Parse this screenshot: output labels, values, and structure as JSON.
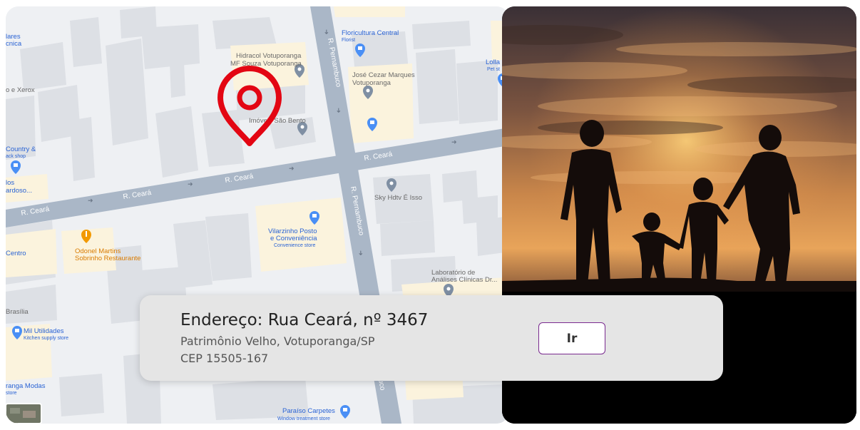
{
  "map": {
    "streets": {
      "ceara_1": "R. Ceará",
      "ceara_2": "R. Ceará",
      "ceara_3": "R. Ceará",
      "ceara_4": "R. Ceará",
      "pernambuco_1": "R. Pernambuco",
      "pernambuco_2": "R. Pernambuco",
      "pernambuco_3": "uco"
    },
    "places": {
      "hidracol_1": "Hidracol Votuporanga",
      "hidracol_2": "MF Souza Votuporanga",
      "imoveis": "Imóveis São Bento",
      "floricultura": "Floricultura Central",
      "floricultura_sub": "Florist",
      "jose_1": "José Cezar Marques",
      "jose_2": "Votuporanga",
      "lolla": "Lolla",
      "lolla_sub": "Pet st",
      "sky": "Sky Hdtv É Isso",
      "vilarzinho_1": "Vilarzinho Posto",
      "vilarzinho_2": "e Conveniência",
      "vilarzinho_sub": "Convenience store",
      "odonel_1": "Odonel Martins",
      "odonel_2": "Sobrinho Restaurante",
      "lab_1": "Laboratório de",
      "lab_2": "Análises Clínicas Dr...",
      "mil_1": "Mil Utilidades",
      "mil_sub": "Kitchen supply store",
      "paraiso_1": "Paraíso Carpetes",
      "paraiso_sub": "Window treatment store",
      "left_lares": "lares",
      "left_cnica": "cnica",
      "left_xerox": "o e Xerox",
      "left_country": "Country &",
      "left_snack": "ack shop",
      "left_los": "los",
      "left_cardoso": "ardoso...",
      "left_centro": "Centro",
      "left_brasilia": "Brasília",
      "left_modas": "ranga Modas",
      "left_store": "store"
    }
  },
  "address": {
    "title": "Endereço: Rua Ceará, nº 3467",
    "line1": "Patrimônio Velho, Votuporanga/SP",
    "line2": "CEP 15505-167"
  },
  "button": {
    "label": "Ir"
  },
  "colors": {
    "pin": "#e30613",
    "road": "#aab7c7",
    "block": "#d9dde3",
    "button_border": "#7a2a8f"
  },
  "icons": {
    "pin": "map-pin-icon",
    "place": "place-marker-icon",
    "shop": "shop-marker-icon",
    "restaurant": "restaurant-marker-icon"
  }
}
